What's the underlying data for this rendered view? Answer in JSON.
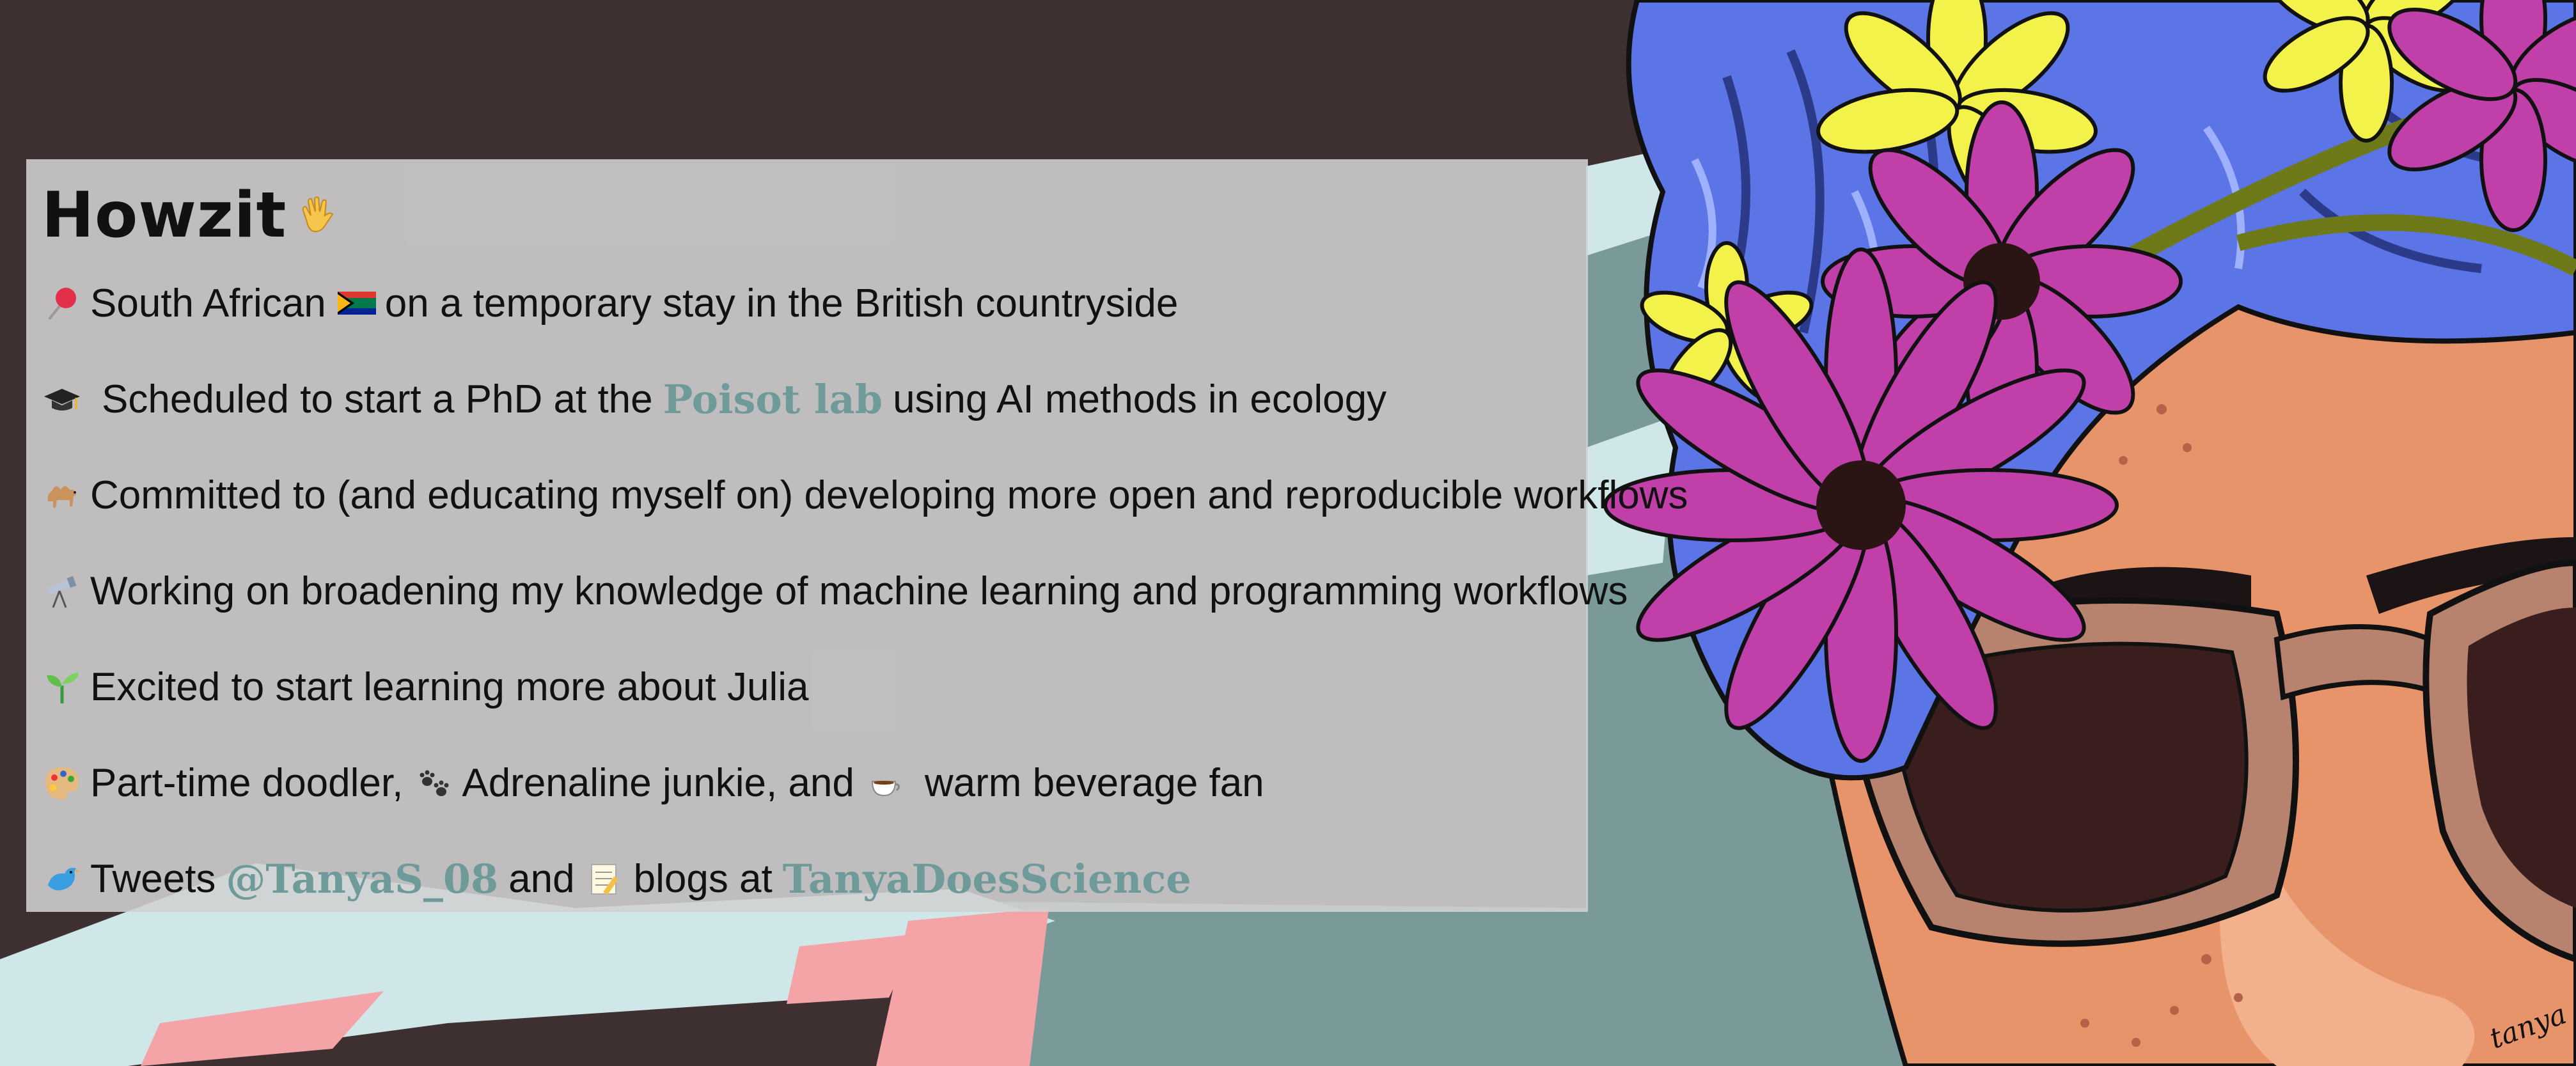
{
  "card": {
    "title": "Howzit",
    "title_icon": "waving-hand-icon",
    "lines": [
      {
        "icon": "round-pushpin-icon",
        "text": "South African",
        "flag_icon": "south-africa-flag-icon",
        "text_after": "on a temporary stay in the British countryside"
      },
      {
        "icon": "graduation-cap-icon",
        "text_before": "Scheduled to start a PhD at the",
        "link_text": "Poisot lab",
        "text_after": "using AI methods in ecology"
      },
      {
        "icon": "camel-icon",
        "text": "Committed to (and educating myself on) developing more open and reproducible workflows"
      },
      {
        "icon": "telescope-icon",
        "text": "Working on broadening my knowledge of machine learning and programming workflows"
      },
      {
        "icon": "seedling-icon",
        "text": "Excited to start learning more about Julia"
      },
      {
        "icon": "artist-palette-icon",
        "text_1": "Part-time doodler,",
        "icon_2": "paw-prints-icon",
        "text_2": "Adrenaline junkie, and",
        "icon_3": "hot-beverage-icon",
        "text_3": "warm beverage fan"
      },
      {
        "icon": "bird-icon",
        "text_1": "Tweets",
        "link_1": "@TanyaS_08",
        "text_2": "and",
        "icon_2": "memo-icon",
        "text_3": "blogs at",
        "link_2": "TanyaDoesScience"
      }
    ]
  },
  "illustration": {
    "signature": "tanya",
    "colors": {
      "background_dark": "#3e2f30",
      "hair_blue": "#5b74e6",
      "flower_magenta": "#c13fa8",
      "flower_yellow": "#f2f24a",
      "skin": "#e8946a",
      "sunglasses_frame": "#b7836e",
      "lens_dark": "#3a1d1d",
      "teal_bg": "#7a9999",
      "link_teal": "#6e9b9a"
    }
  }
}
